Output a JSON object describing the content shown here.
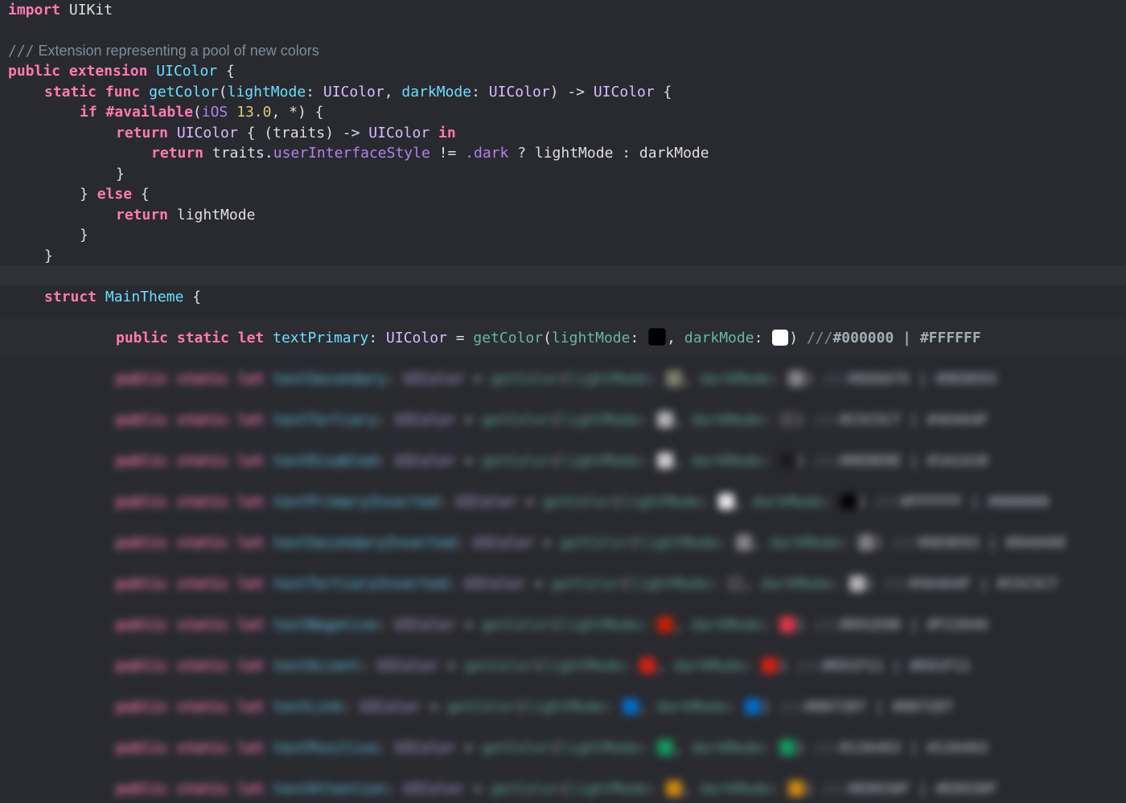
{
  "code": {
    "l1": {
      "kw": "import",
      "rest": " UIKit"
    },
    "l3": {
      "slashes": "///",
      "text": " Extension representing a pool of new colors"
    },
    "l4": {
      "kw1": "public",
      "kw2": "extension",
      "type": "UIColor",
      "brace": " {"
    },
    "l5": {
      "kw1": "static",
      "kw2": "func",
      "fn": "getColor",
      "p1": "lightMode",
      "t1": "UIColor",
      "p2": "darkMode",
      "t2": "UIColor",
      "arrow": ") -> ",
      "ret": "UIColor",
      "brace": " {"
    },
    "l6": {
      "kw1": "if",
      "kw2": "#available",
      "os": "iOS",
      "ver": "13.0",
      "rest": ", *) {"
    },
    "l7": {
      "kw": "return",
      "type": "UIColor",
      "mid": " { (traits) -> ",
      "type2": "UIColor",
      "kw2": "in"
    },
    "l8": {
      "kw": "return",
      "obj": " traits.",
      "prop": "userInterfaceStyle",
      "op": " != ",
      "dark": ".dark",
      "rest": " ? lightMode : darkMode"
    },
    "l9": {
      "text": "}"
    },
    "l10": {
      "close": "} ",
      "kw": "else",
      "brace": " {"
    },
    "l11": {
      "kw": "return",
      "rest": " lightMode"
    },
    "l12": {
      "text": "}"
    },
    "l13": {
      "text": "}"
    },
    "l15": {
      "kw": "struct",
      "type": "MainTheme",
      "brace": " {"
    },
    "l17": {
      "kw1": "public",
      "kw2": "static",
      "kw3": "let",
      "name": "textPrimary",
      "colon": ": ",
      "type": "UIColor",
      "eq": " = ",
      "fn": "getColor",
      "p1": "lightMode",
      "p2": "darkMode",
      "comment_slashes": "///",
      "light_hex": "#000000",
      "sep": " | ",
      "dark_hex": "#FFFFFF"
    }
  },
  "blurred_rows": [
    {
      "name": "textSecondary",
      "light": "#8A8A75",
      "dark": "#8E8E93",
      "light_hex": "#8A8A75",
      "dark_hex": "#8E8E93"
    },
    {
      "name": "textTertiary",
      "light": "#C5C5C7",
      "dark": "#4A4A4F",
      "light_hex": "#C5C5C7",
      "dark_hex": "#4A4A4F"
    },
    {
      "name": "textDisabled",
      "light": "#DEDEDE",
      "dark": "#1A1A1D",
      "light_hex": "#DEDEDE",
      "dark_hex": "#1A1A1D"
    },
    {
      "name": "textPrimaryInverted",
      "light": "#FFFFFF",
      "dark": "#000000",
      "light_hex": "#FFFFFF",
      "dark_hex": "#000000"
    },
    {
      "name": "textSecondaryInverted",
      "light": "#8E8E93",
      "dark": "#8A8A8E",
      "light_hex": "#8E8E93",
      "dark_hex": "#8A8A8E"
    },
    {
      "name": "textTertiaryInverted",
      "light": "#4A4A4F",
      "dark": "#C5C5C7",
      "light_hex": "#4A4A4F",
      "dark_hex": "#C5C5C7"
    },
    {
      "name": "textNegative",
      "light": "#D91E00",
      "dark": "#F2384A",
      "light_hex": "#D91E00",
      "dark_hex": "#F2384A"
    },
    {
      "name": "textAccent",
      "light": "#E81F11",
      "dark": "#E81F11",
      "light_hex": "#E81F11",
      "dark_hex": "#E81F11"
    },
    {
      "name": "textLink",
      "light": "#0072D7",
      "dark": "#0072D7",
      "light_hex": "#0072D7",
      "dark_hex": "#0072D7"
    },
    {
      "name": "textPositive",
      "light": "#13A463",
      "dark": "#13A463",
      "light_hex": "#13A463",
      "dark_hex": "#13A463"
    },
    {
      "name": "textAttention",
      "light": "#E0930F",
      "dark": "#E0930F",
      "light_hex": "#E0930F",
      "dark_hex": "#E0930F"
    }
  ],
  "blur_tokens": {
    "kw1": "public",
    "kw2": "static",
    "kw3": "let",
    "type": "UIColor",
    "fn": "getColor",
    "p1": "lightMode",
    "p2": "darkMode",
    "slashes": "///",
    "sep": " | "
  },
  "colors": {
    "background": "#292a30",
    "current_line": "#2f3239",
    "keyword": "#ff7ab2",
    "type": "#dabaff",
    "function": "#67b7a4",
    "comment": "#7f8c98"
  }
}
